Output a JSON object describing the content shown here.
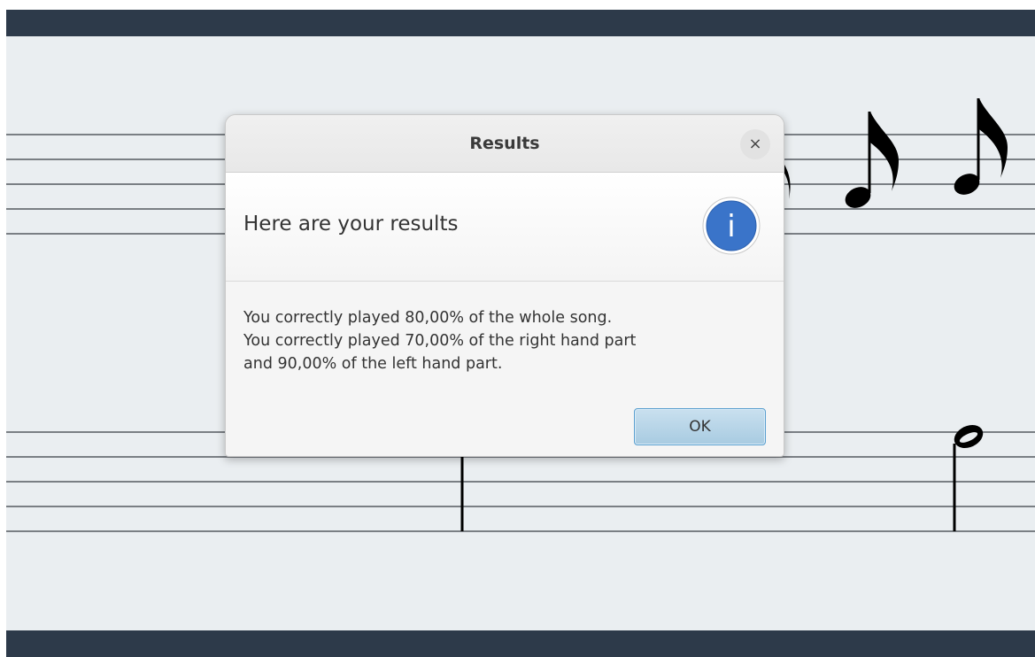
{
  "dialog": {
    "title": "Results",
    "close_symbol": "×",
    "header_text": "Here are your results",
    "header_icon": "info-icon",
    "icon_letter": "i",
    "content_lines": [
      "You correctly played 80,00% of the whole song.",
      "You correctly played 70,00% of the right hand part",
      "and 90,00% of the left hand part."
    ],
    "ok_label": "OK"
  },
  "colors": {
    "app_bar": "#2d3a4a",
    "canvas": "#eaeef1",
    "info_blue": "#3a74c9",
    "ok_button": "#b6d5ea"
  }
}
